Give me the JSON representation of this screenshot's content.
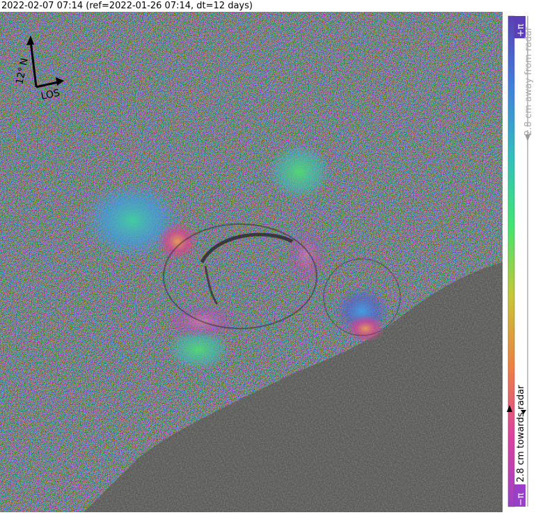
{
  "header": {
    "title": "2022-02-07 07:14 (ref=2022-01-26 07:14, dt=12 days)"
  },
  "compass": {
    "north_label": "N",
    "heading_label": "12°",
    "los_label": "LOS"
  },
  "colorbar": {
    "top_label": "+π",
    "bottom_label": "−π",
    "upper_text": "2.8 cm away from radar",
    "lower_text": "2.8 cm towards radar",
    "colors": [
      "#5b3fb8",
      "#3f7fe0",
      "#2fc0c0",
      "#3fe870",
      "#c8c830",
      "#f08040",
      "#e040a0",
      "#9a40c8"
    ]
  }
}
